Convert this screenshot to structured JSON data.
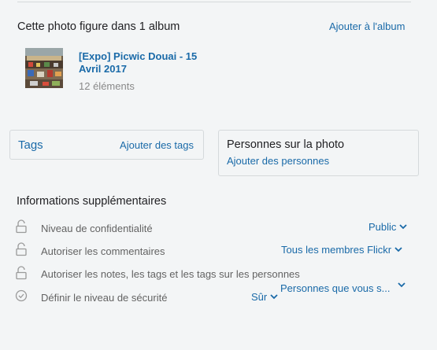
{
  "album": {
    "heading": "Cette photo figure dans 1 album",
    "add_link": "Ajouter à l'album",
    "title": "[Expo] Picwic Douai - 15 Avril 2017",
    "count": "12 éléments"
  },
  "tags": {
    "title": "Tags",
    "add_link": "Ajouter des tags"
  },
  "people": {
    "title": "Personnes sur la photo",
    "add_link": "Ajouter des personnes"
  },
  "info": {
    "heading": "Informations supplémentaires",
    "rows": [
      {
        "label": "Niveau de confidentialité",
        "value": "Public",
        "icon": "open-lock-icon"
      },
      {
        "label": "Autoriser les commentaires",
        "value": "Tous les membres Flickr",
        "icon": "open-lock-icon"
      },
      {
        "label": "Autoriser les notes, les tags et les tags sur les personnes",
        "value": "Personnes que vous s...",
        "icon": "open-lock-icon"
      },
      {
        "label": "Définir le niveau de sécurité",
        "value": "Sûr",
        "icon": "check-circle-icon"
      }
    ]
  },
  "colors": {
    "link": "#1a6aa8",
    "background": "#f3f5f6",
    "border": "#d5d9db"
  }
}
